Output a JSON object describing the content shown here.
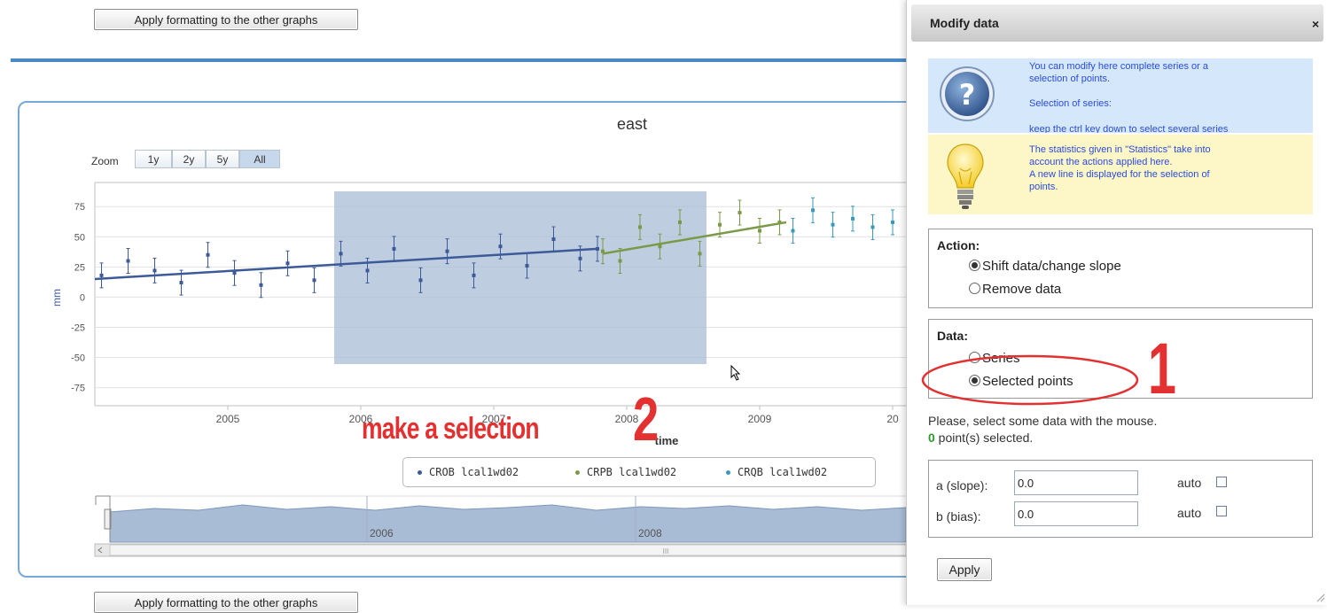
{
  "page": {
    "apply_format_top": "Apply formatting to the other graphs",
    "apply_format_bottom": "Apply formatting to the other graphs"
  },
  "chart": {
    "title": "east",
    "zoom_label": "Zoom",
    "zoom_buttons": [
      "1y",
      "2y",
      "5y",
      "All"
    ],
    "zoom_active": "All",
    "ylabel": "mm",
    "xlabel": "time",
    "navigator_labels": [
      "2006",
      "2008"
    ],
    "scroll_grip": "III"
  },
  "chart_data": {
    "type": "scatter",
    "title": "east",
    "xlabel": "time",
    "ylabel": "mm",
    "x_ticks": [
      "2005",
      "2006",
      "2007",
      "2008",
      "2009",
      "20"
    ],
    "y_ticks": [
      75,
      50,
      25,
      0,
      -25,
      -50,
      -75
    ],
    "ylim": [
      -90,
      95
    ],
    "xlim": [
      2004.0,
      2010.1
    ],
    "error_bars": true,
    "series": [
      {
        "name": "CROB lcal1wd02",
        "color": "#3d5a98",
        "x": [
          2004.05,
          2004.25,
          2004.45,
          2004.65,
          2004.85,
          2005.05,
          2005.25,
          2005.45,
          2005.65,
          2005.85,
          2006.05,
          2006.25,
          2006.45,
          2006.65,
          2006.85,
          2007.05,
          2007.25,
          2007.45,
          2007.65,
          2007.78
        ],
        "y": [
          18,
          30,
          22,
          12,
          35,
          20,
          10,
          28,
          14,
          36,
          22,
          40,
          14,
          38,
          18,
          42,
          26,
          48,
          32,
          40
        ],
        "trend": [
          [
            2004.0,
            15
          ],
          [
            2007.78,
            40
          ]
        ]
      },
      {
        "name": "CRPB lcal1wd02",
        "color": "#7a9a48",
        "x": [
          2007.82,
          2007.95,
          2008.1,
          2008.25,
          2008.4,
          2008.55,
          2008.7,
          2008.85,
          2009.0,
          2009.15
        ],
        "y": [
          38,
          30,
          58,
          42,
          62,
          36,
          60,
          70,
          55,
          62
        ],
        "trend": [
          [
            2007.82,
            36
          ],
          [
            2009.2,
            62
          ]
        ]
      },
      {
        "name": "CRQB lcal1wd02",
        "color": "#3a9ab8",
        "x": [
          2009.25,
          2009.4,
          2009.55,
          2009.7,
          2009.85,
          2010.0
        ],
        "y": [
          55,
          72,
          60,
          65,
          58,
          62
        ]
      }
    ],
    "selection_x": [
      2005.8,
      2008.6
    ],
    "legend_position": "bottom",
    "navigator": {
      "ticks": [
        "2006",
        "2008"
      ]
    }
  },
  "legend": {
    "items": [
      {
        "label": "CROB lcal1wd02",
        "color": "#3d5a98"
      },
      {
        "label": "CRPB lcal1wd02",
        "color": "#7a9a48"
      },
      {
        "label": "CRQB lcal1wd02",
        "color": "#3a9ab8"
      }
    ]
  },
  "annotations": {
    "make_selection": "make a selection",
    "step1": "1",
    "step2": "2"
  },
  "dialog": {
    "title": "Modify data",
    "close": "×",
    "info_lines": [
      "You can modify here complete series or a",
      "selection of points.",
      "",
      "Selection of series:",
      "keep the ctrl key down to select several series"
    ],
    "tip_lines": [
      "The statistics given in \"Statistics\" take into",
      "account the actions applied here.",
      "A new line is displayed for the selection of",
      "points."
    ],
    "action": {
      "title": "Action:",
      "options": [
        "Shift data/change slope",
        "Remove data"
      ],
      "selected": "Shift data/change slope"
    },
    "data": {
      "title": "Data:",
      "options": [
        "Series",
        "Selected points"
      ],
      "selected": "Selected points"
    },
    "prompt": "Please, select some data with the mouse.",
    "selected_count": "0",
    "selected_suffix": " point(s) selected.",
    "params": {
      "slope_label": "a (slope):",
      "slope_value": "0.0",
      "bias_label": "b (bias):",
      "bias_value": "0.0",
      "auto_label": "auto"
    },
    "apply": "Apply"
  },
  "colors": {
    "accent": "#4a89c8",
    "annotation": "#e33131",
    "selection": "#a9bcd6",
    "info_bg": "#d5e8fb",
    "tip_bg": "#fdf7c8"
  }
}
